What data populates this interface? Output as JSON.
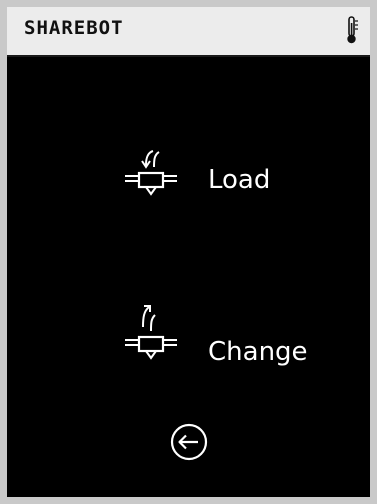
{
  "window": {
    "title": "SHAREBOT",
    "status_icon": "thermometer-icon"
  },
  "menu": {
    "items": [
      {
        "label": "Load",
        "icon": "filament-load-icon"
      },
      {
        "label": "Change",
        "icon": "filament-change-icon"
      }
    ]
  },
  "navigation": {
    "back_icon": "back-arrow-icon"
  },
  "colors": {
    "screen_background": "#000000",
    "title_bar_background": "#ececec",
    "foreground": "#ffffff",
    "frame_border": "#c9c9c9"
  }
}
